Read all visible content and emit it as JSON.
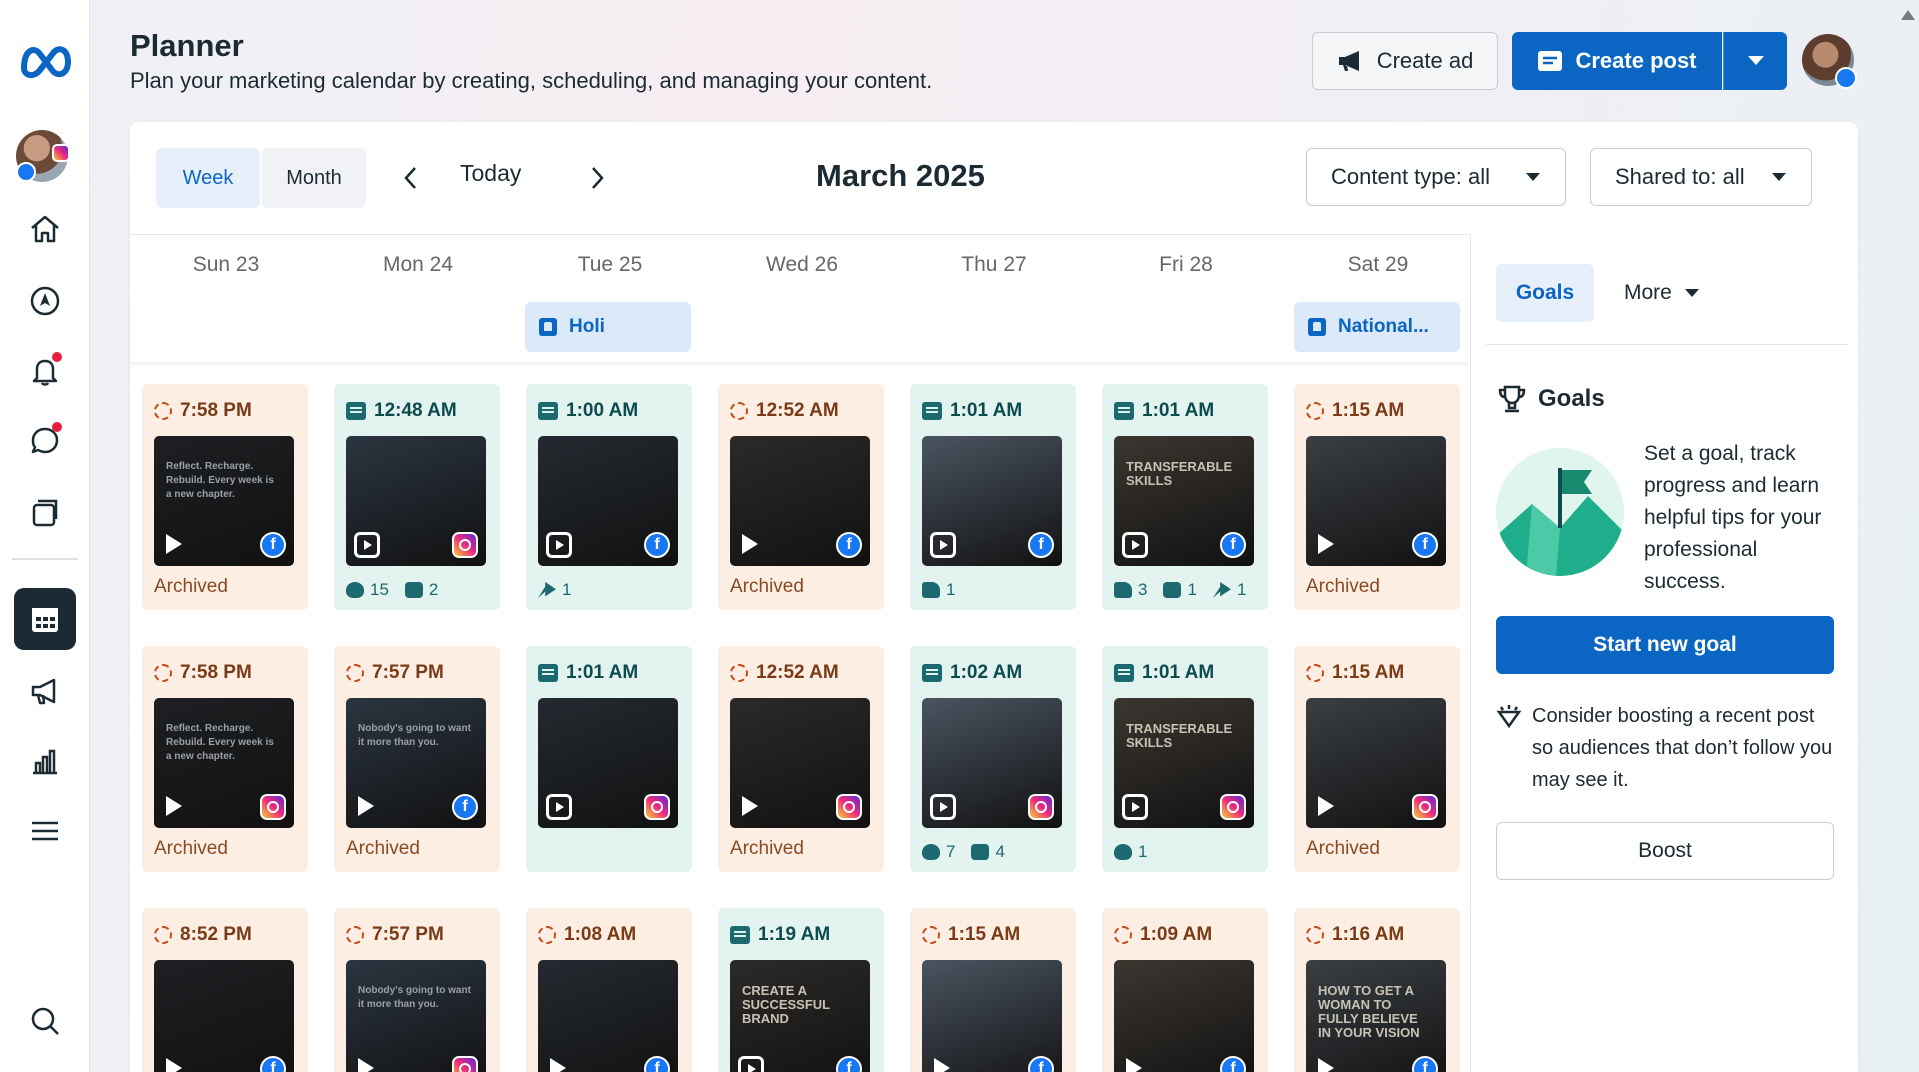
{
  "colors": {
    "accent": "#0a66c2",
    "archived_bg": "#fdeee3",
    "published_bg": "#e3f3ef",
    "rail_active": "#1c2b33"
  },
  "rail": {
    "items": [
      {
        "name": "home-icon",
        "top": 0
      },
      {
        "name": "explore-icon"
      },
      {
        "name": "notifications-icon"
      },
      {
        "name": "inbox-icon"
      },
      {
        "name": "content-icon"
      },
      {
        "name": "planner-icon"
      },
      {
        "name": "ads-icon"
      },
      {
        "name": "insights-icon"
      },
      {
        "name": "menu-icon"
      },
      {
        "name": "search-icon"
      }
    ]
  },
  "header": {
    "title": "Planner",
    "subtitle": "Plan your marketing calendar by creating, scheduling, and managing your content.",
    "create_ad": "Create ad",
    "create_post": "Create post"
  },
  "toolbar": {
    "week": "Week",
    "month": "Month",
    "today": "Today",
    "month_label": "March 2025",
    "content_type": "Content type: all",
    "shared_to": "Shared to: all"
  },
  "days": [
    "Sun 23",
    "Mon 24",
    "Tue 25",
    "Wed 26",
    "Thu 27",
    "Fri 28",
    "Sat 29"
  ],
  "events": [
    {
      "day": 2,
      "label": "Holi"
    },
    {
      "day": 6,
      "label": "National..."
    }
  ],
  "posts": [
    {
      "day": 0,
      "row": 0,
      "time": "7:58 PM",
      "kind": "archived",
      "media": "video",
      "platform": "fb",
      "status": "Archived",
      "thumb": "Reflect. Recharge. Rebuild. Every week is a new chapter.",
      "stats": []
    },
    {
      "day": 1,
      "row": 0,
      "time": "12:48 AM",
      "kind": "published",
      "media": "reel",
      "platform": "ig",
      "status": "",
      "thumb": "",
      "stats": [
        {
          "icon": "heart",
          "value": "15"
        },
        {
          "icon": "comment",
          "value": "2"
        }
      ]
    },
    {
      "day": 2,
      "row": 0,
      "time": "1:00 AM",
      "kind": "published",
      "media": "reel",
      "platform": "fb",
      "status": "",
      "thumb": "",
      "stats": [
        {
          "icon": "share",
          "value": "1"
        }
      ]
    },
    {
      "day": 3,
      "row": 0,
      "time": "12:52 AM",
      "kind": "archived",
      "media": "video",
      "platform": "fb",
      "status": "Archived",
      "thumb": "",
      "stats": []
    },
    {
      "day": 4,
      "row": 0,
      "time": "1:01 AM",
      "kind": "published",
      "media": "reel",
      "platform": "fb",
      "status": "",
      "thumb": "",
      "stats": [
        {
          "icon": "like",
          "value": "1"
        }
      ]
    },
    {
      "day": 5,
      "row": 0,
      "time": "1:01 AM",
      "kind": "published",
      "media": "reel",
      "platform": "fb",
      "status": "",
      "thumb": "TRANSFERABLE SKILLS",
      "stats": [
        {
          "icon": "like",
          "value": "3"
        },
        {
          "icon": "comment",
          "value": "1"
        },
        {
          "icon": "share",
          "value": "1"
        }
      ]
    },
    {
      "day": 6,
      "row": 0,
      "time": "1:15 AM",
      "kind": "archived",
      "media": "video",
      "platform": "fb",
      "status": "Archived",
      "thumb": "",
      "stats": []
    },
    {
      "day": 0,
      "row": 1,
      "time": "7:58 PM",
      "kind": "archived",
      "media": "video",
      "platform": "ig",
      "status": "Archived",
      "thumb": "Reflect. Recharge. Rebuild. Every week is a new chapter.",
      "stats": []
    },
    {
      "day": 1,
      "row": 1,
      "time": "7:57 PM",
      "kind": "archived",
      "media": "video",
      "platform": "fb",
      "status": "Archived",
      "thumb": "Nobody's going to want it more than you.",
      "stats": []
    },
    {
      "day": 2,
      "row": 1,
      "time": "1:01 AM",
      "kind": "published",
      "media": "reel",
      "platform": "ig",
      "status": "",
      "thumb": "",
      "stats": []
    },
    {
      "day": 3,
      "row": 1,
      "time": "12:52 AM",
      "kind": "archived",
      "media": "video",
      "platform": "ig",
      "status": "Archived",
      "thumb": "",
      "stats": []
    },
    {
      "day": 4,
      "row": 1,
      "time": "1:02 AM",
      "kind": "published",
      "media": "reel",
      "platform": "ig",
      "status": "",
      "thumb": "",
      "stats": [
        {
          "icon": "heart",
          "value": "7"
        },
        {
          "icon": "comment",
          "value": "4"
        }
      ]
    },
    {
      "day": 5,
      "row": 1,
      "time": "1:01 AM",
      "kind": "published",
      "media": "reel",
      "platform": "ig",
      "status": "",
      "thumb": "TRANSFERABLE SKILLS",
      "stats": [
        {
          "icon": "heart",
          "value": "1"
        }
      ]
    },
    {
      "day": 6,
      "row": 1,
      "time": "1:15 AM",
      "kind": "archived",
      "media": "video",
      "platform": "ig",
      "status": "Archived",
      "thumb": "",
      "stats": []
    },
    {
      "day": 0,
      "row": 2,
      "time": "8:52 PM",
      "kind": "archived",
      "media": "video",
      "platform": "fb",
      "status": "",
      "thumb": "",
      "stats": []
    },
    {
      "day": 1,
      "row": 2,
      "time": "7:57 PM",
      "kind": "archived",
      "media": "video",
      "platform": "ig",
      "status": "",
      "thumb": "Nobody's going to want it more than you.",
      "stats": []
    },
    {
      "day": 2,
      "row": 2,
      "time": "1:08 AM",
      "kind": "archived",
      "media": "video",
      "platform": "fb",
      "status": "",
      "thumb": "",
      "stats": []
    },
    {
      "day": 3,
      "row": 2,
      "time": "1:19 AM",
      "kind": "published",
      "media": "reel",
      "platform": "fb",
      "status": "",
      "thumb": "CREATE A SUCCESSFUL BRAND",
      "stats": []
    },
    {
      "day": 4,
      "row": 2,
      "time": "1:15 AM",
      "kind": "archived",
      "media": "video",
      "platform": "fb",
      "status": "",
      "thumb": "",
      "stats": []
    },
    {
      "day": 5,
      "row": 2,
      "time": "1:09 AM",
      "kind": "archived",
      "media": "video",
      "platform": "fb",
      "status": "",
      "thumb": "",
      "stats": []
    },
    {
      "day": 6,
      "row": 2,
      "time": "1:16 AM",
      "kind": "archived",
      "media": "video",
      "platform": "fb",
      "status": "",
      "thumb": "HOW TO GET A WOMAN TO FULLY BELIEVE IN YOUR VISION",
      "stats": []
    }
  ],
  "sidebar": {
    "tab_goals": "Goals",
    "tab_more": "More",
    "goals_title": "Goals",
    "goals_text": "Set a goal, track progress and learn helpful tips for your professional success.",
    "start_goal": "Start new goal",
    "boost_tip": "Consider boosting a recent post so audiences that don’t follow you may see it.",
    "boost": "Boost"
  }
}
